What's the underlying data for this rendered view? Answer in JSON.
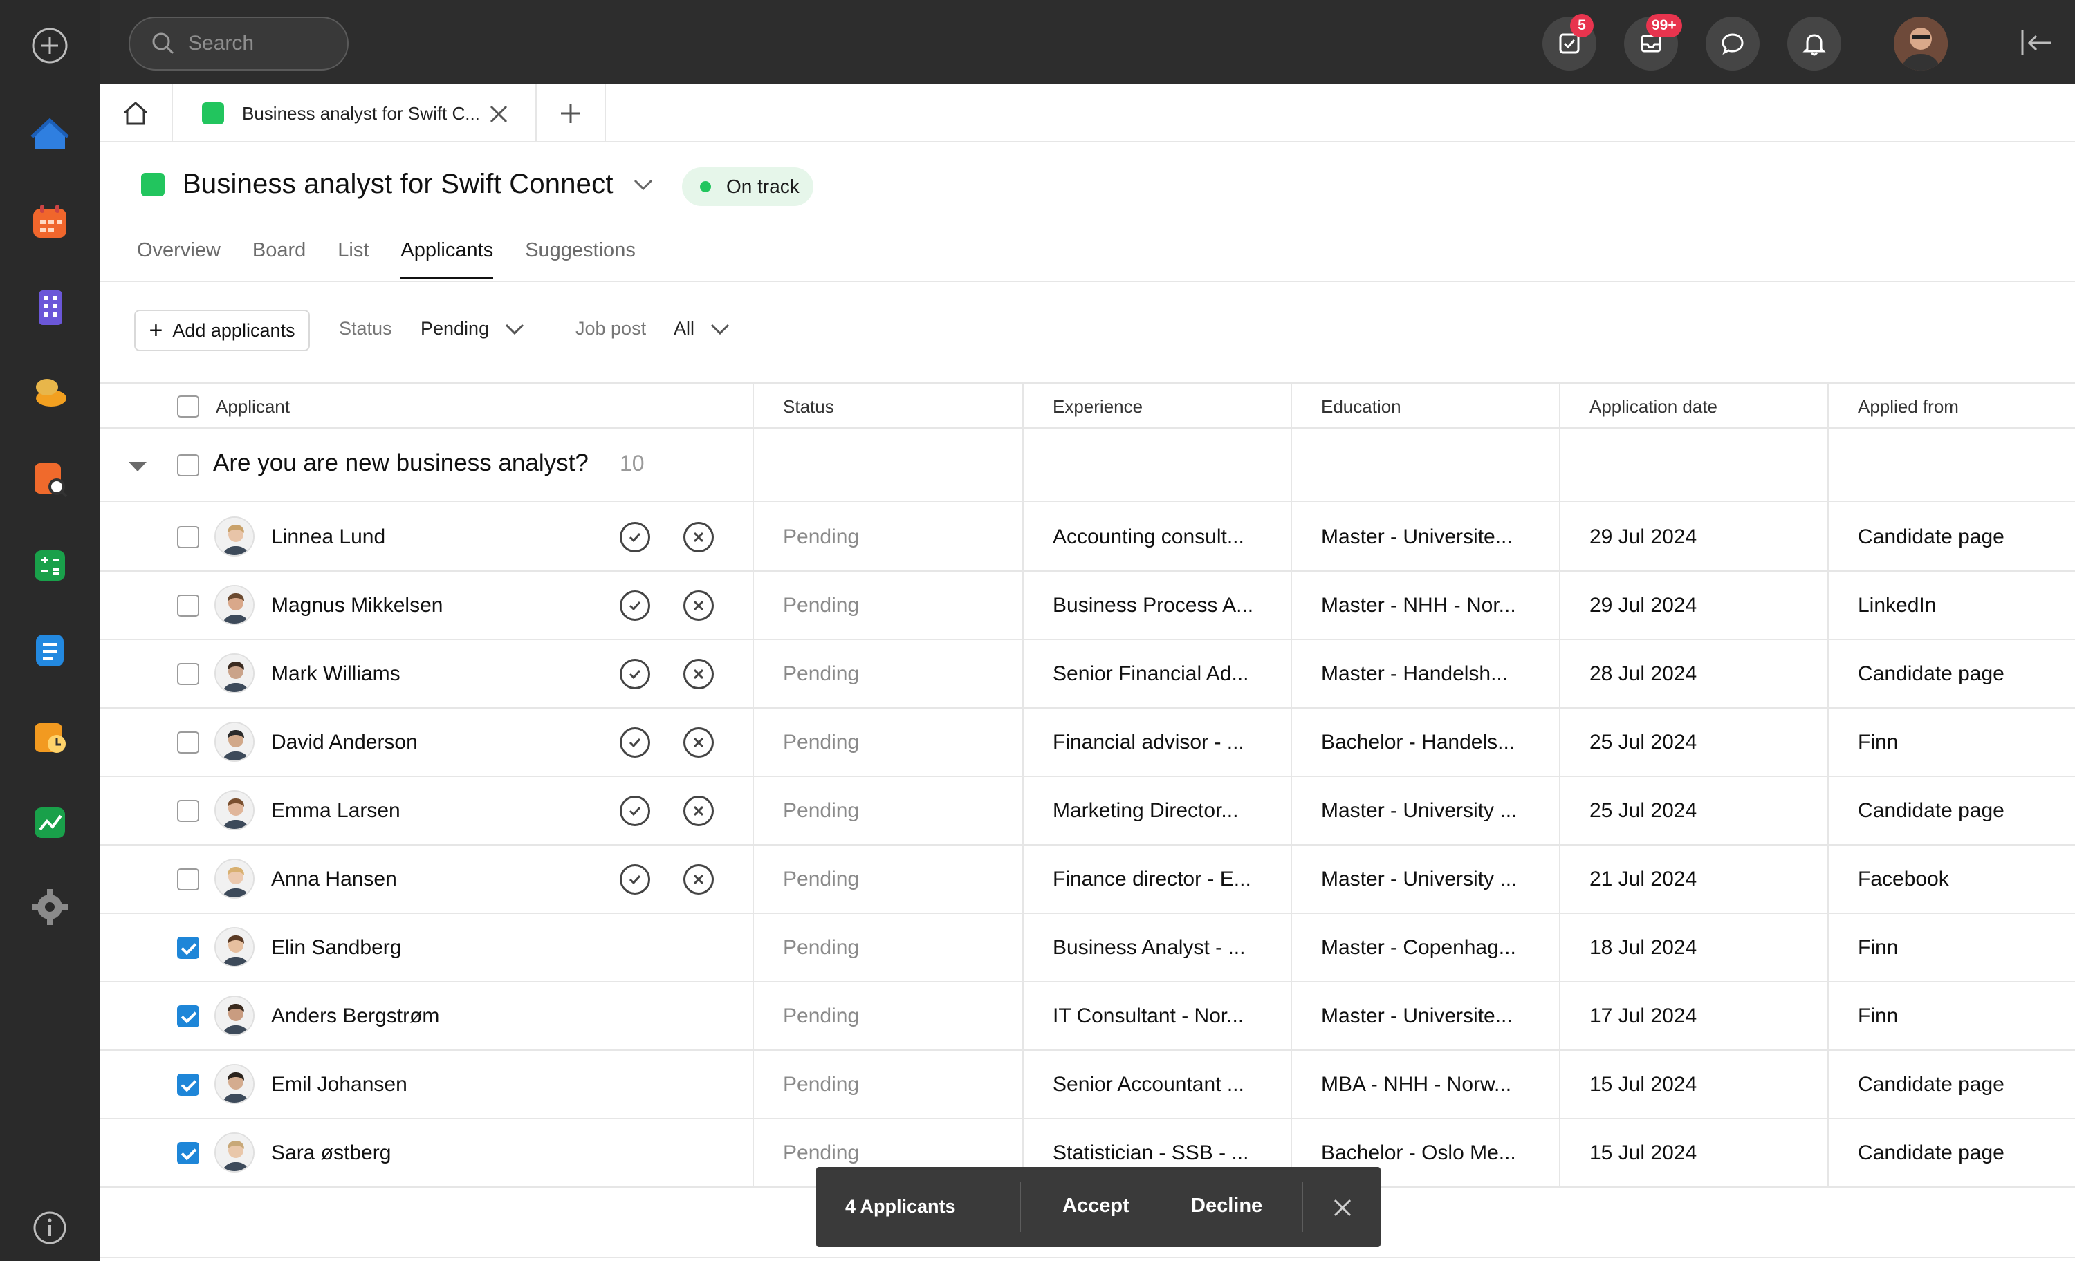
{
  "topbar": {
    "search_placeholder": "Search",
    "tasks_badge": "5",
    "mail_badge": "99+"
  },
  "rail": {
    "apps": [
      {
        "name": "home",
        "color": "#2f7fe0"
      },
      {
        "name": "calendar",
        "color": "#f0662c"
      },
      {
        "name": "buildings",
        "color": "#6b57d8"
      },
      {
        "name": "finance",
        "color": "#f2a020"
      },
      {
        "name": "recruiting",
        "color": "#f06a2c"
      },
      {
        "name": "spreadsheet",
        "color": "#19a04a"
      },
      {
        "name": "documents",
        "color": "#2389e0"
      },
      {
        "name": "timesheet",
        "color": "#f29a20"
      },
      {
        "name": "analytics",
        "color": "#19a04a"
      },
      {
        "name": "settings",
        "color": "#8a8a8a"
      }
    ]
  },
  "tabs": {
    "doc_tab_label": "Business analyst for Swift C..."
  },
  "project": {
    "title": "Business analyst for Swift Connect",
    "status": "On track"
  },
  "nav": [
    "Overview",
    "Board",
    "List",
    "Applicants",
    "Suggestions"
  ],
  "filters": {
    "add_label": "Add applicants",
    "status_label": "Status",
    "status_value": "Pending",
    "jobpost_label": "Job post",
    "jobpost_value": "All"
  },
  "table": {
    "columns": [
      "Applicant",
      "Status",
      "Experience",
      "Education",
      "Application date",
      "Applied from"
    ],
    "group": {
      "title": "Are you are new business analyst?",
      "count": "10"
    },
    "rows": [
      {
        "name": "Linnea Lund",
        "status": "Pending",
        "experience": "Accounting consult...",
        "education": "Master - Universite...",
        "date": "29 Jul 2024",
        "source": "Candidate page",
        "checked": false,
        "actions": true
      },
      {
        "name": "Magnus Mikkelsen",
        "status": "Pending",
        "experience": "Business Process A...",
        "education": "Master - NHH - Nor...",
        "date": "29 Jul 2024",
        "source": "LinkedIn",
        "checked": false,
        "actions": true
      },
      {
        "name": "Mark Williams",
        "status": "Pending",
        "experience": "Senior Financial Ad...",
        "education": "Master - Handelsh...",
        "date": "28 Jul 2024",
        "source": "Candidate page",
        "checked": false,
        "actions": true
      },
      {
        "name": "David Anderson",
        "status": "Pending",
        "experience": "Financial advisor - ...",
        "education": "Bachelor - Handels...",
        "date": "25 Jul 2024",
        "source": "Finn",
        "checked": false,
        "actions": true
      },
      {
        "name": "Emma Larsen",
        "status": "Pending",
        "experience": "Marketing Director...",
        "education": "Master - University ...",
        "date": "25 Jul 2024",
        "source": "Candidate page",
        "checked": false,
        "actions": true
      },
      {
        "name": "Anna Hansen",
        "status": "Pending",
        "experience": "Finance director - E...",
        "education": "Master - University ...",
        "date": "21 Jul 2024",
        "source": "Facebook",
        "checked": false,
        "actions": true
      },
      {
        "name": "Elin Sandberg",
        "status": "Pending",
        "experience": "Business Analyst - ...",
        "education": "Master - Copenhag...",
        "date": "18 Jul 2024",
        "source": "Finn",
        "checked": true,
        "actions": false
      },
      {
        "name": "Anders Bergstrøm",
        "status": "Pending",
        "experience": "IT Consultant - Nor...",
        "education": "Master - Universite...",
        "date": "17 Jul 2024",
        "source": "Finn",
        "checked": true,
        "actions": false
      },
      {
        "name": "Emil Johansen",
        "status": "Pending",
        "experience": "Senior Accountant ...",
        "education": "MBA - NHH - Norw...",
        "date": "15 Jul 2024",
        "source": "Candidate page",
        "checked": true,
        "actions": false
      },
      {
        "name": "Sara østberg",
        "status": "Pending",
        "experience": "Statistician - SSB - ...",
        "education": "Bachelor - Oslo Me...",
        "date": "15 Jul 2024",
        "source": "Candidate page",
        "checked": true,
        "actions": false
      }
    ]
  },
  "actionbar": {
    "selected_label": "4 Applicants",
    "accept_label": "Accept",
    "decline_label": "Decline"
  }
}
